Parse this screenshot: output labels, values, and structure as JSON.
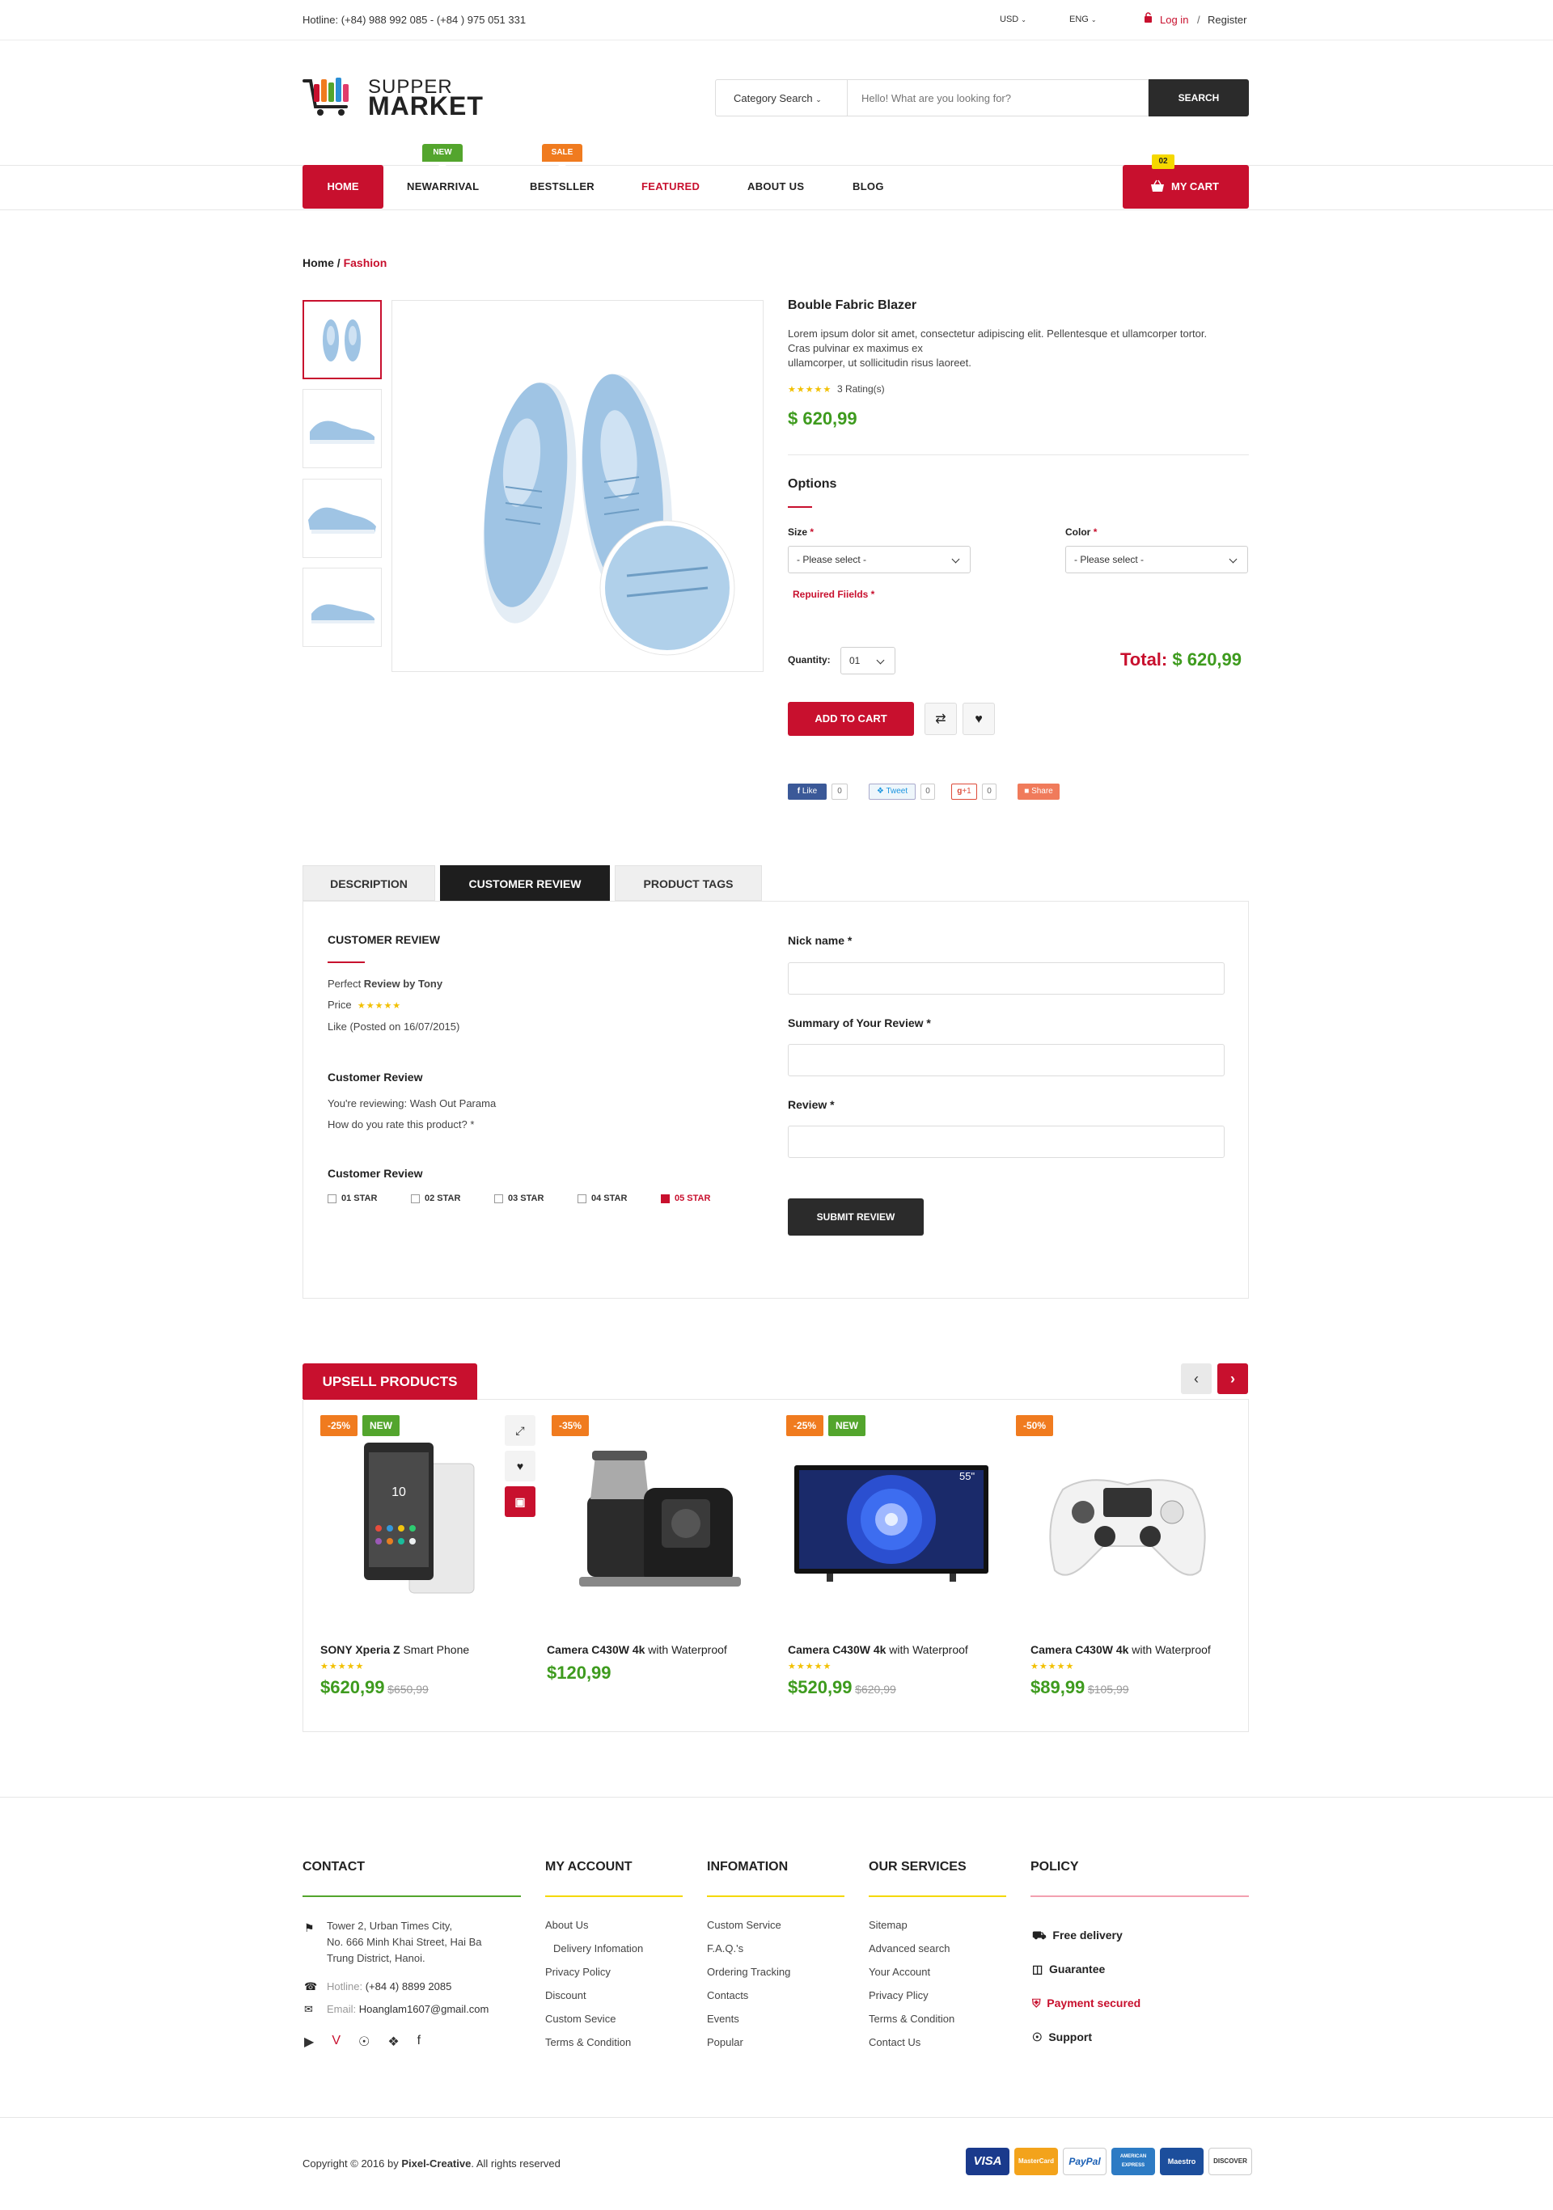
{
  "topbar": {
    "hotline": "Hotline: (+84) 988 992 085 - (+84 ) 975 051 331",
    "currency": "USD",
    "language": "ENG",
    "login": "Log in",
    "separator": "/",
    "register": "Register"
  },
  "header": {
    "logo_top": "SUPPER",
    "logo_bottom": "MARKET",
    "category_label": "Category Search",
    "search_placeholder": "Hello! What are you looking for?",
    "search_button": "SEARCH"
  },
  "nav": {
    "items": [
      "HOME",
      "NEWARRIVAL",
      "BESTSLLER",
      "FEATURED",
      "ABOUT US",
      "BLOG"
    ],
    "new_badge": "NEW",
    "sale_badge": "SALE",
    "cart_count": "02",
    "cart_label": "MY CART"
  },
  "breadcrumb": {
    "home": "Home",
    "sep": "/",
    "current": "Fashion"
  },
  "product": {
    "title": "Bouble Fabric Blazer",
    "desc1": "Lorem ipsum dolor sit amet, consectetur adipiscing elit. Pellentesque et ullamcorper tortor.",
    "desc2": "Cras pulvinar ex maximus ex",
    "desc3": "ullamcorper, ut sollicitudin risus laoreet.",
    "stars": "★★★★★",
    "rating": "3 Rating(s)",
    "price": "$ 620,99",
    "options_title": "Options",
    "size_label": "Size",
    "color_label": "Color",
    "required_mark": "*",
    "size_select": "- Please select -",
    "color_select": "- Please select -",
    "required_fields": "Repuired Fiields *",
    "quantity_label": "Quantity:",
    "quantity_value": "01",
    "total_label": "Total:",
    "total_value": "$ 620,99",
    "add_to_cart": "ADD TO CART",
    "social": {
      "like": "Like",
      "like_count": "0",
      "tweet": "Tweet",
      "tweet_count": "0",
      "gplus": "+1",
      "gplus_count": "0",
      "share": "Share"
    }
  },
  "tabs": {
    "items": [
      "DESCRIPTION",
      "CUSTOMER REVIEW",
      "PRODUCT TAGS"
    ],
    "active": 1
  },
  "review": {
    "heading": "CUSTOMER REVIEW",
    "line1_pre": "Perfect ",
    "line1_bold": "Review by Tony",
    "price_label": "Price",
    "stars": "★★★★★",
    "posted": "Like (Posted on 16/07/2015)",
    "sub_heading1": "Customer Review",
    "reviewing": "You're reviewing: Wash Out Parama",
    "how_rate": "How do you rate this product? *",
    "sub_heading2": "Customer Review",
    "star_options": [
      "01 STAR",
      "02 STAR",
      "03 STAR",
      "04 STAR",
      "05 STAR"
    ],
    "nick_label": "Nick name *",
    "summary_label": "Summary of Your Review *",
    "review_label": "Review *",
    "submit": "SUBMIT REVIEW"
  },
  "upsell": {
    "title": "UPSELL PRODUCTS",
    "products": [
      {
        "discount": "-25%",
        "new": "NEW",
        "name_bold": "SONY Xperia Z",
        "name_rest": " Smart Phone",
        "stars": "★★★★★",
        "price": "$620,99",
        "old": "$650,99"
      },
      {
        "discount": "-35%",
        "new": "",
        "name_bold": "Camera C430W 4k",
        "name_rest": " with Waterproof",
        "stars": "",
        "price": "$120,99",
        "old": ""
      },
      {
        "discount": "-25%",
        "new": "NEW",
        "name_bold": "Camera C430W 4k",
        "name_rest": " with Waterproof",
        "stars": "★★★★★",
        "price": "$520,99",
        "old": "$620,99"
      },
      {
        "discount": "-50%",
        "new": "",
        "name_bold": "Camera C430W 4k",
        "name_rest": " with Waterproof",
        "stars": "★★★★★",
        "price": "$89,99",
        "old": "$105,99"
      }
    ]
  },
  "footer": {
    "contact": {
      "title": "CONTACT",
      "addr1": "Tower 2, Urban Times City,",
      "addr2": "No. 666 Minh Khai Street,  Hai Ba",
      "addr3": "Trung District, Hanoi.",
      "hotline_label": "Hotline:",
      "hotline": "(+84 4) 8899 2085",
      "email_label": "Email:",
      "email": "Hoanglam1607@gmail.com"
    },
    "account": {
      "title": "MY ACCOUNT",
      "links": [
        "About Us",
        "Delivery Infomation",
        "Privacy Policy",
        "Discount",
        "Custom Sevice",
        "Terms & Condition"
      ]
    },
    "info": {
      "title": "INFOMATION",
      "links": [
        "Custom Service",
        "F.A.Q.'s",
        "Ordering Tracking",
        "Contacts",
        "Events",
        "Popular"
      ]
    },
    "services": {
      "title": "OUR SERVICES",
      "links": [
        "Sitemap",
        "Advanced search",
        "Your Account",
        "Privacy Plicy",
        "Terms & Condition",
        "Contact Us"
      ]
    },
    "policy": {
      "title": "POLICY",
      "items": [
        "Free delivery",
        "Guarantee",
        "Payment secured",
        "Support"
      ]
    },
    "copyright_pre": "Copyright © 2016 by ",
    "copyright_brand": "Pixel-Creative",
    "copyright_post": ". All rights reserved",
    "cards": [
      "VISA",
      "MasterCard",
      "PayPal",
      "AMERICAN EXPRESS",
      "Maestro",
      "DISCOVER"
    ]
  },
  "colors": {
    "accent": "#c8102e",
    "price_green": "#3e9b1e",
    "dark": "#1e1e1e",
    "orange": "#f07b1f",
    "new_green": "#53a52d"
  }
}
